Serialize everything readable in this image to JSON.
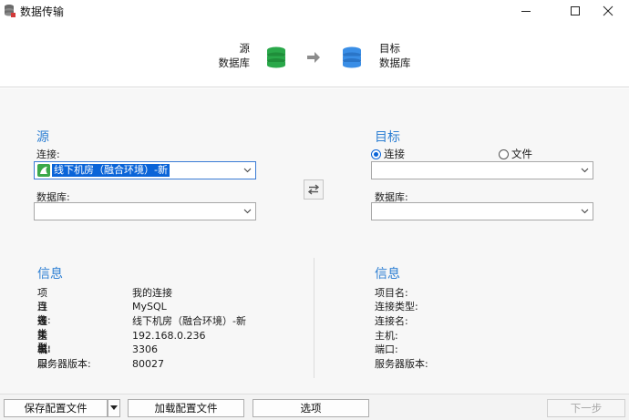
{
  "window": {
    "title": "数据传输"
  },
  "header": {
    "source_line1": "源",
    "source_line2": "数据库",
    "target_line1": "目标",
    "target_line2": "数据库"
  },
  "source": {
    "title": "源",
    "connection_label": "连接:",
    "connection_value": "线下机房（融合环境）-新",
    "database_label": "数据库:",
    "database_value": ""
  },
  "target": {
    "title": "目标",
    "radio_connection": "连接",
    "radio_file": "文件",
    "connection_value": "",
    "database_label": "数据库:",
    "database_value": ""
  },
  "source_info": {
    "title": "信息",
    "rows": [
      {
        "key": "项目名:",
        "value": "我的连接"
      },
      {
        "key": "连接类型:",
        "value": "MySQL"
      },
      {
        "key": "连接名:",
        "value": "线下机房（融合环境）-新"
      },
      {
        "key": "主机:",
        "value": "192.168.0.236"
      },
      {
        "key": "端口:",
        "value": "3306"
      },
      {
        "key": "服务器版本:",
        "value": "80027"
      }
    ]
  },
  "target_info": {
    "title": "信息",
    "rows": [
      {
        "key": "项目名:",
        "value": ""
      },
      {
        "key": "连接类型:",
        "value": ""
      },
      {
        "key": "连接名:",
        "value": ""
      },
      {
        "key": "主机:",
        "value": ""
      },
      {
        "key": "端口:",
        "value": ""
      },
      {
        "key": "服务器版本:",
        "value": ""
      }
    ]
  },
  "footer": {
    "save_config": "保存配置文件",
    "load_config": "加载配置文件",
    "options": "选项",
    "next": "下一步"
  },
  "colors": {
    "accent": "#2d7fd3",
    "source_db": "#2aa84a",
    "target_db": "#3a8ee6",
    "selection": "#0a64d8"
  }
}
